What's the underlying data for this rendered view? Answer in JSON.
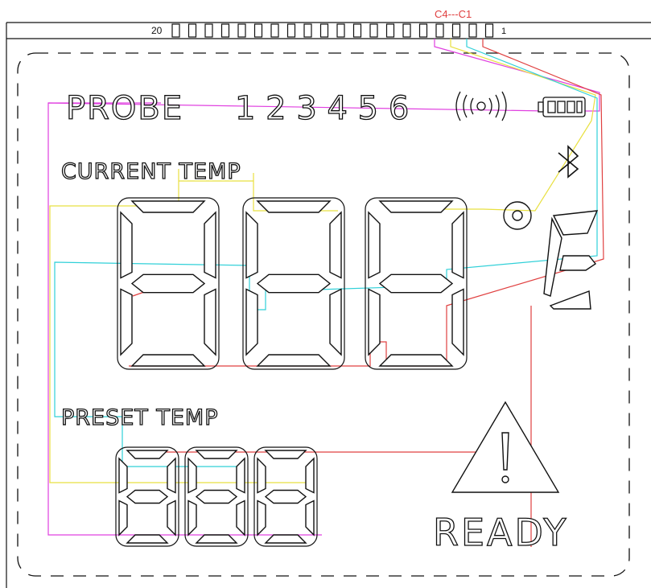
{
  "header": {
    "pin_left_number": "20",
    "pin_right_number": "1",
    "common_label": "C4---C1"
  },
  "labels": {
    "probe": "PROBE",
    "probe_numbers": "1 2 3 4 5 6",
    "current_temp": "CURRENT   TEMP",
    "preset_temp": "PRESET   TEMP",
    "ready": "READY",
    "unit": "F"
  },
  "colors": {
    "common_c1": "#e06060",
    "common_c2": "#30d0d8",
    "common_c3": "#e8e040",
    "common_c4": "#e040e0",
    "outline": "#111111",
    "background": "#ffffff"
  },
  "icons": {
    "signal": "wireless-signal-icon",
    "battery": "battery-icon",
    "bluetooth": "bluetooth-icon",
    "degree": "degree-symbol-icon",
    "warning": "warning-triangle-icon"
  }
}
